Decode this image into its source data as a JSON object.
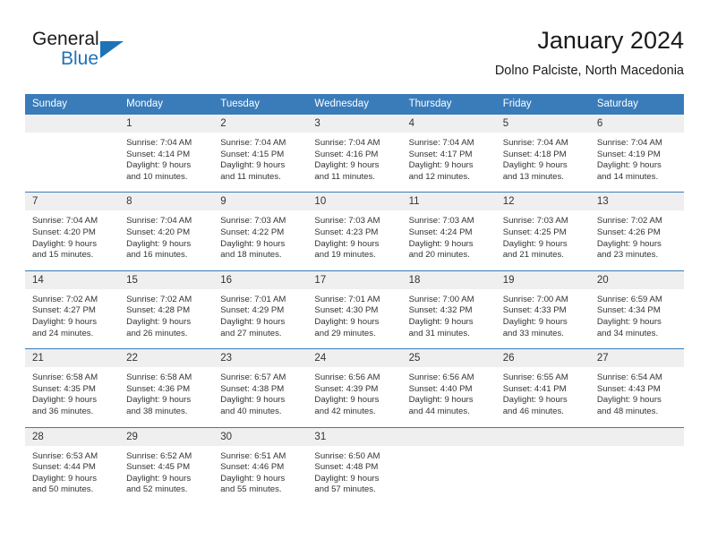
{
  "brand": {
    "name_part1": "General",
    "name_part2": "Blue",
    "logo_icon": "triangle-flag-icon",
    "accent_color": "#1e72b8"
  },
  "header": {
    "title": "January 2024",
    "subtitle": "Dolno Palciste, North Macedonia"
  },
  "theme": {
    "header_bg": "#3a7cba",
    "daynum_bg": "#efefef",
    "text": "#333333"
  },
  "weekdays": [
    "Sunday",
    "Monday",
    "Tuesday",
    "Wednesday",
    "Thursday",
    "Friday",
    "Saturday"
  ],
  "weeks": [
    [
      {
        "day": "",
        "lines": []
      },
      {
        "day": "1",
        "lines": [
          "Sunrise: 7:04 AM",
          "Sunset: 4:14 PM",
          "Daylight: 9 hours",
          "and 10 minutes."
        ]
      },
      {
        "day": "2",
        "lines": [
          "Sunrise: 7:04 AM",
          "Sunset: 4:15 PM",
          "Daylight: 9 hours",
          "and 11 minutes."
        ]
      },
      {
        "day": "3",
        "lines": [
          "Sunrise: 7:04 AM",
          "Sunset: 4:16 PM",
          "Daylight: 9 hours",
          "and 11 minutes."
        ]
      },
      {
        "day": "4",
        "lines": [
          "Sunrise: 7:04 AM",
          "Sunset: 4:17 PM",
          "Daylight: 9 hours",
          "and 12 minutes."
        ]
      },
      {
        "day": "5",
        "lines": [
          "Sunrise: 7:04 AM",
          "Sunset: 4:18 PM",
          "Daylight: 9 hours",
          "and 13 minutes."
        ]
      },
      {
        "day": "6",
        "lines": [
          "Sunrise: 7:04 AM",
          "Sunset: 4:19 PM",
          "Daylight: 9 hours",
          "and 14 minutes."
        ]
      }
    ],
    [
      {
        "day": "7",
        "lines": [
          "Sunrise: 7:04 AM",
          "Sunset: 4:20 PM",
          "Daylight: 9 hours",
          "and 15 minutes."
        ]
      },
      {
        "day": "8",
        "lines": [
          "Sunrise: 7:04 AM",
          "Sunset: 4:20 PM",
          "Daylight: 9 hours",
          "and 16 minutes."
        ]
      },
      {
        "day": "9",
        "lines": [
          "Sunrise: 7:03 AM",
          "Sunset: 4:22 PM",
          "Daylight: 9 hours",
          "and 18 minutes."
        ]
      },
      {
        "day": "10",
        "lines": [
          "Sunrise: 7:03 AM",
          "Sunset: 4:23 PM",
          "Daylight: 9 hours",
          "and 19 minutes."
        ]
      },
      {
        "day": "11",
        "lines": [
          "Sunrise: 7:03 AM",
          "Sunset: 4:24 PM",
          "Daylight: 9 hours",
          "and 20 minutes."
        ]
      },
      {
        "day": "12",
        "lines": [
          "Sunrise: 7:03 AM",
          "Sunset: 4:25 PM",
          "Daylight: 9 hours",
          "and 21 minutes."
        ]
      },
      {
        "day": "13",
        "lines": [
          "Sunrise: 7:02 AM",
          "Sunset: 4:26 PM",
          "Daylight: 9 hours",
          "and 23 minutes."
        ]
      }
    ],
    [
      {
        "day": "14",
        "lines": [
          "Sunrise: 7:02 AM",
          "Sunset: 4:27 PM",
          "Daylight: 9 hours",
          "and 24 minutes."
        ]
      },
      {
        "day": "15",
        "lines": [
          "Sunrise: 7:02 AM",
          "Sunset: 4:28 PM",
          "Daylight: 9 hours",
          "and 26 minutes."
        ]
      },
      {
        "day": "16",
        "lines": [
          "Sunrise: 7:01 AM",
          "Sunset: 4:29 PM",
          "Daylight: 9 hours",
          "and 27 minutes."
        ]
      },
      {
        "day": "17",
        "lines": [
          "Sunrise: 7:01 AM",
          "Sunset: 4:30 PM",
          "Daylight: 9 hours",
          "and 29 minutes."
        ]
      },
      {
        "day": "18",
        "lines": [
          "Sunrise: 7:00 AM",
          "Sunset: 4:32 PM",
          "Daylight: 9 hours",
          "and 31 minutes."
        ]
      },
      {
        "day": "19",
        "lines": [
          "Sunrise: 7:00 AM",
          "Sunset: 4:33 PM",
          "Daylight: 9 hours",
          "and 33 minutes."
        ]
      },
      {
        "day": "20",
        "lines": [
          "Sunrise: 6:59 AM",
          "Sunset: 4:34 PM",
          "Daylight: 9 hours",
          "and 34 minutes."
        ]
      }
    ],
    [
      {
        "day": "21",
        "lines": [
          "Sunrise: 6:58 AM",
          "Sunset: 4:35 PM",
          "Daylight: 9 hours",
          "and 36 minutes."
        ]
      },
      {
        "day": "22",
        "lines": [
          "Sunrise: 6:58 AM",
          "Sunset: 4:36 PM",
          "Daylight: 9 hours",
          "and 38 minutes."
        ]
      },
      {
        "day": "23",
        "lines": [
          "Sunrise: 6:57 AM",
          "Sunset: 4:38 PM",
          "Daylight: 9 hours",
          "and 40 minutes."
        ]
      },
      {
        "day": "24",
        "lines": [
          "Sunrise: 6:56 AM",
          "Sunset: 4:39 PM",
          "Daylight: 9 hours",
          "and 42 minutes."
        ]
      },
      {
        "day": "25",
        "lines": [
          "Sunrise: 6:56 AM",
          "Sunset: 4:40 PM",
          "Daylight: 9 hours",
          "and 44 minutes."
        ]
      },
      {
        "day": "26",
        "lines": [
          "Sunrise: 6:55 AM",
          "Sunset: 4:41 PM",
          "Daylight: 9 hours",
          "and 46 minutes."
        ]
      },
      {
        "day": "27",
        "lines": [
          "Sunrise: 6:54 AM",
          "Sunset: 4:43 PM",
          "Daylight: 9 hours",
          "and 48 minutes."
        ]
      }
    ],
    [
      {
        "day": "28",
        "lines": [
          "Sunrise: 6:53 AM",
          "Sunset: 4:44 PM",
          "Daylight: 9 hours",
          "and 50 minutes."
        ]
      },
      {
        "day": "29",
        "lines": [
          "Sunrise: 6:52 AM",
          "Sunset: 4:45 PM",
          "Daylight: 9 hours",
          "and 52 minutes."
        ]
      },
      {
        "day": "30",
        "lines": [
          "Sunrise: 6:51 AM",
          "Sunset: 4:46 PM",
          "Daylight: 9 hours",
          "and 55 minutes."
        ]
      },
      {
        "day": "31",
        "lines": [
          "Sunrise: 6:50 AM",
          "Sunset: 4:48 PM",
          "Daylight: 9 hours",
          "and 57 minutes."
        ]
      },
      {
        "day": "",
        "lines": []
      },
      {
        "day": "",
        "lines": []
      },
      {
        "day": "",
        "lines": []
      }
    ]
  ]
}
